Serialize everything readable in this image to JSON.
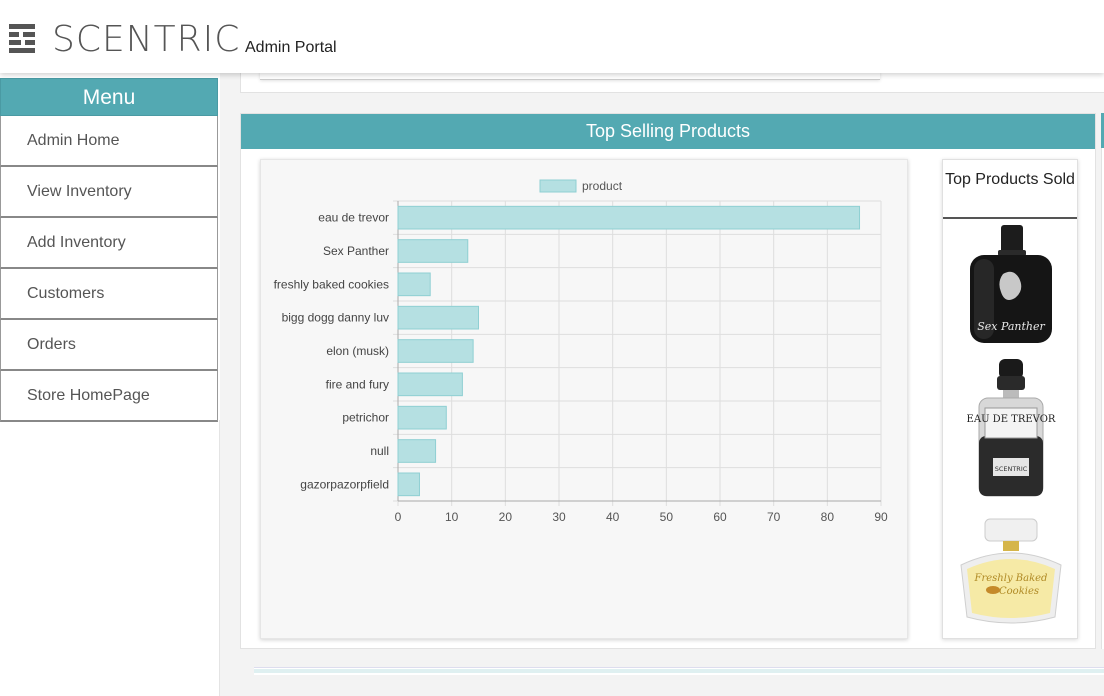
{
  "header": {
    "brand": "SCENTRIC",
    "portal": "Admin Portal",
    "logo_icon": "scentric-logo-icon"
  },
  "sidebar": {
    "title": "Menu",
    "items": [
      {
        "label": "Admin Home"
      },
      {
        "label": "View Inventory"
      },
      {
        "label": "Add Inventory"
      },
      {
        "label": "Customers"
      },
      {
        "label": "Orders"
      },
      {
        "label": "Store HomePage"
      }
    ]
  },
  "sales": {
    "title": "Top Selling Products",
    "top_products_title": "Top Products Sold",
    "products": [
      {
        "name": "Sex Panther",
        "image_text": "Sex Panther"
      },
      {
        "name": "Eau de Trevor",
        "image_text": "EAU DE TREVOR",
        "image_sub": "SCENTRIC"
      },
      {
        "name": "Freshly Baked Cookies",
        "image_text": "Freshly Baked Cookies"
      }
    ]
  },
  "colors": {
    "accent": "#53a9b2",
    "bar_fill": "#b5e0e2",
    "bar_stroke": "#8fcfd3"
  },
  "chart_data": {
    "type": "bar",
    "orientation": "horizontal",
    "categories": [
      "eau de trevor",
      "Sex Panther",
      "freshly baked cookies",
      "bigg dogg danny luv",
      "elon (musk)",
      "fire and fury",
      "petrichor",
      "null",
      "gazorpazorpfield"
    ],
    "series": [
      {
        "name": "product",
        "values": [
          86,
          13,
          6,
          15,
          14,
          12,
          9,
          7,
          4
        ]
      }
    ],
    "x_ticks": [
      0,
      10,
      20,
      30,
      40,
      50,
      60,
      70,
      80,
      90
    ],
    "xlim": [
      0,
      90
    ],
    "grid": true,
    "legend": "top"
  }
}
